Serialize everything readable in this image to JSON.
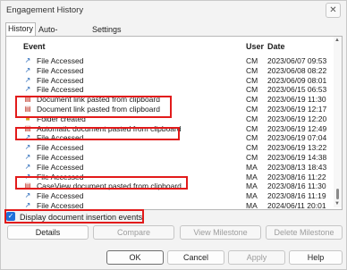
{
  "window": {
    "title": "Engagement History",
    "close_symbol": "✕"
  },
  "tabs": [
    {
      "label": "History",
      "active": true
    },
    {
      "label": "Auto-Compare",
      "active": false
    },
    {
      "label": "Settings",
      "active": false
    }
  ],
  "table": {
    "headers": {
      "event": "Event",
      "user": "User",
      "date": "Date"
    },
    "rows": [
      {
        "icon": "link-arrow-icon",
        "event": "File Accessed",
        "user": "CM",
        "date": "2023/06/07 09:53"
      },
      {
        "icon": "link-arrow-icon",
        "event": "File Accessed",
        "user": "CM",
        "date": "2023/06/08 08:22"
      },
      {
        "icon": "link-arrow-icon",
        "event": "File Accessed",
        "user": "CM",
        "date": "2023/06/09 08:01"
      },
      {
        "icon": "link-arrow-icon",
        "event": "File Accessed",
        "user": "CM",
        "date": "2023/06/15 06:53"
      },
      {
        "icon": "document-icon",
        "event": "Document link pasted from clipboard",
        "user": "CM",
        "date": "2023/06/19 11:30"
      },
      {
        "icon": "document-icon",
        "event": "Document link pasted from clipboard",
        "user": "CM",
        "date": "2023/06/19 12:17"
      },
      {
        "icon": "folder-icon",
        "event": "Folder created",
        "user": "CM",
        "date": "2023/06/19 12:20"
      },
      {
        "icon": "document-icon",
        "event": "Automatic document pasted from clipboard",
        "user": "CM",
        "date": "2023/06/19 12:49"
      },
      {
        "icon": "link-arrow-icon",
        "event": "File Accessed",
        "user": "CM",
        "date": "2023/06/19 07:04"
      },
      {
        "icon": "link-arrow-icon",
        "event": "File Accessed",
        "user": "CM",
        "date": "2023/06/19 13:22"
      },
      {
        "icon": "link-arrow-icon",
        "event": "File Accessed",
        "user": "CM",
        "date": "2023/06/19 14:38"
      },
      {
        "icon": "link-arrow-icon",
        "event": "File Accessed",
        "user": "MA",
        "date": "2023/08/13 18:43"
      },
      {
        "icon": "link-arrow-icon",
        "event": "File Accessed",
        "user": "MA",
        "date": "2023/08/16 11:22"
      },
      {
        "icon": "document-icon",
        "event": "CaseView document pasted from clipboard",
        "user": "MA",
        "date": "2023/08/16 11:30"
      },
      {
        "icon": "link-arrow-icon",
        "event": "File Accessed",
        "user": "MA",
        "date": "2023/08/16 11:19"
      },
      {
        "icon": "link-arrow-icon",
        "event": "File Accessed",
        "user": "MA",
        "date": "2024/06/11 20:01"
      }
    ]
  },
  "checkbox": {
    "label": "Display document insertion events",
    "checked": true,
    "symbol": "✓"
  },
  "action_buttons": {
    "details": "Details",
    "compare": "Compare",
    "view_milestone": "View Milestone",
    "delete_milestone": "Delete Milestone"
  },
  "dialog_buttons": {
    "ok": "OK",
    "cancel": "Cancel",
    "apply": "Apply",
    "help": "Help"
  },
  "colors": {
    "highlight": "#e21b1b",
    "accent": "#1e6fd9"
  }
}
